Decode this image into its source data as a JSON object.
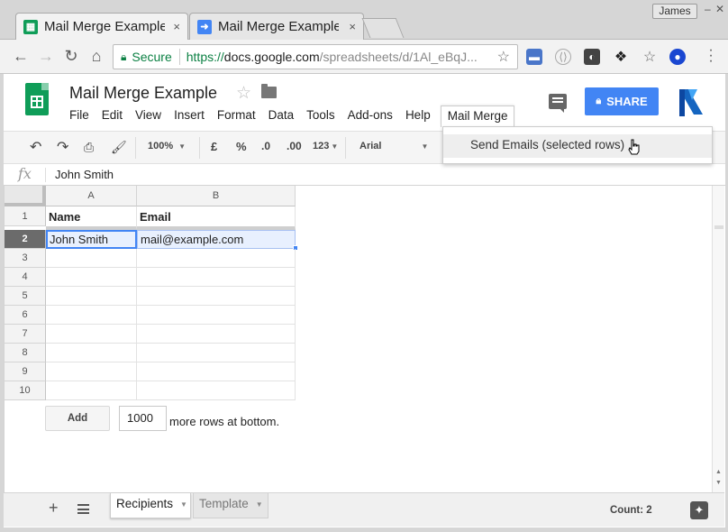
{
  "browser": {
    "user_name": "James",
    "tabs": [
      {
        "title": "Mail Merge Example",
        "icon": "sheets-icon",
        "close": "×"
      },
      {
        "title": "Mail Merge Example",
        "icon": "arrow-right-icon",
        "close": "×"
      }
    ],
    "security_label": "Secure",
    "url": {
      "scheme": "https://",
      "host": "docs.google.com",
      "path": "/spreadsheets/d/1Al_eBqJ..."
    }
  },
  "doc": {
    "title": "Mail Merge Example",
    "menu": [
      "File",
      "Edit",
      "View",
      "Insert",
      "Format",
      "Data",
      "Tools",
      "Add-ons",
      "Help",
      "Mail Merge"
    ],
    "share_label": "SHARE"
  },
  "toolbar": {
    "zoom": "100%",
    "currency": "£",
    "percent": "%",
    "decrease_decimals": ".0",
    "increase_decimals": ".00",
    "more_formats": "123",
    "font": "Arial"
  },
  "dropdown": {
    "items": [
      "Send Emails (selected rows)"
    ]
  },
  "formula_bar": {
    "fx_label": "fx",
    "value": "John Smith"
  },
  "grid": {
    "columns": [
      "A",
      "B"
    ],
    "row_numbers": [
      "1",
      "2",
      "3",
      "4",
      "5",
      "6",
      "7",
      "8",
      "9",
      "10"
    ],
    "rows": [
      [
        "Name",
        "Email"
      ],
      [
        "John Smith",
        "mail@example.com"
      ]
    ],
    "selected_row": 2
  },
  "add_rows": {
    "button_label": "Add",
    "count": "1000",
    "suffix": "more rows at bottom."
  },
  "bottom": {
    "add_sheet": "+",
    "sheets": [
      "Recipients",
      "Template"
    ],
    "active_sheet": "Recipients",
    "count_label": "Count: 2"
  },
  "colors": {
    "sheets_green": "#0f9d58",
    "share_blue": "#4285f4",
    "selection_blue": "#4285f4",
    "secure_green": "#0b8043"
  }
}
